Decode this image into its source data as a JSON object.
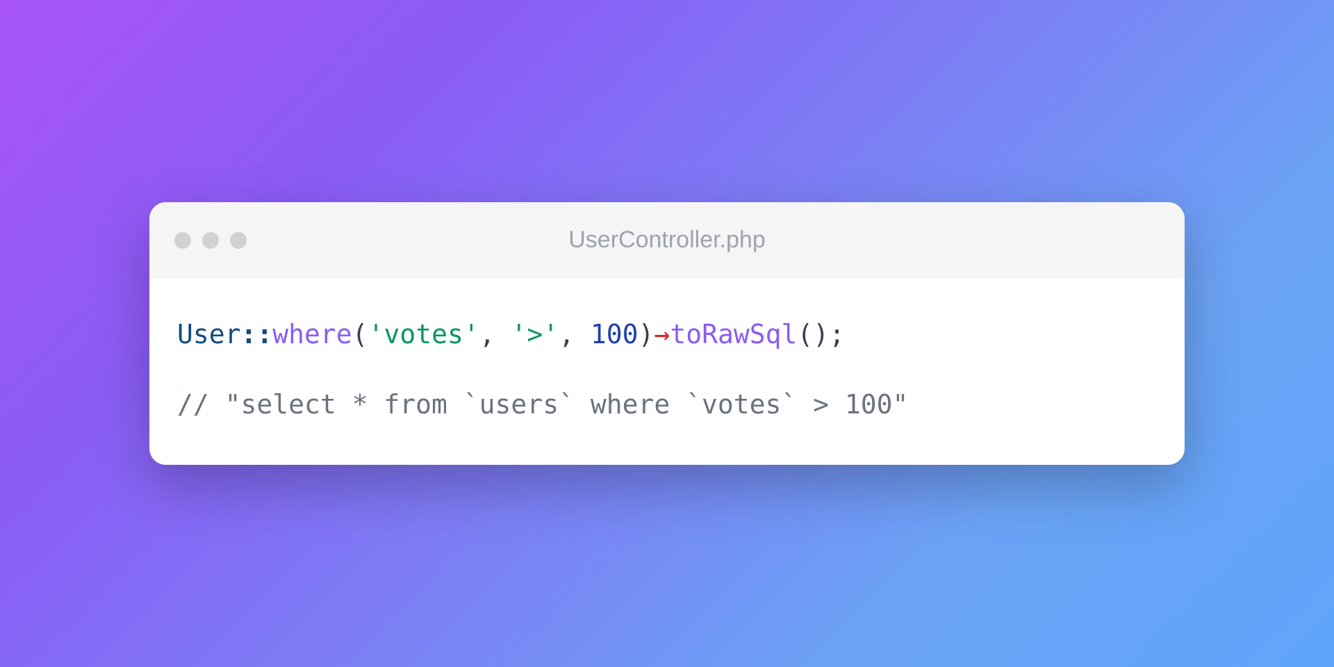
{
  "window": {
    "title": "UserController.php"
  },
  "code": {
    "line1": {
      "class": "User",
      "scope": "::",
      "method1": "where",
      "paren_open1": "(",
      "string1": "'votes'",
      "comma1": ", ",
      "string2": "'>'",
      "comma2": ", ",
      "number": "100",
      "paren_close1": ")",
      "arrow": "→",
      "method2": "toRawSql",
      "paren_open2": "(",
      "paren_close2": ")",
      "semi": ";"
    },
    "line2": {
      "comment": "// \"select * from `users` where `votes` > 100\""
    }
  }
}
